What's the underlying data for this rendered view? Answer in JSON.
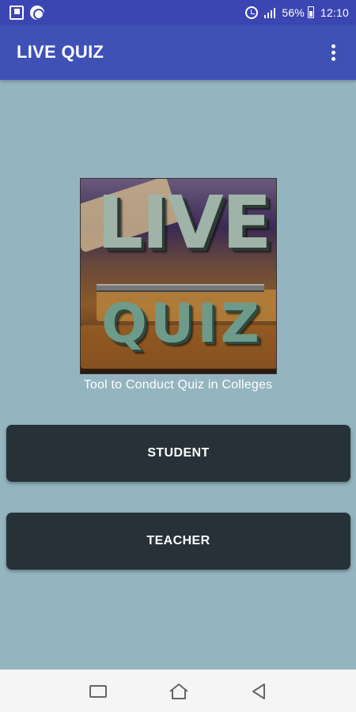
{
  "status_bar": {
    "left_icons": [
      "screen-recorder-icon",
      "circle-app-icon"
    ],
    "signal_label": "ıll",
    "battery_percent": "56%",
    "time": "12:10"
  },
  "app_bar": {
    "title": "LIVE QUIZ",
    "menu_icon": "more-vert-icon"
  },
  "logo": {
    "line1": "LIVE",
    "line2": "QUIZ"
  },
  "tagline": "Tool to Conduct Quiz in Colleges",
  "buttons": {
    "student": "STUDENT",
    "teacher": "TEACHER"
  },
  "nav_bar": {
    "icons": [
      "recent-apps-icon",
      "home-icon",
      "back-icon"
    ]
  },
  "colors": {
    "status_bar": "#3c46b3",
    "app_bar": "#3f51b5",
    "background": "#94b4c0",
    "button": "#263238",
    "nav_bar": "#f5f5f5"
  }
}
